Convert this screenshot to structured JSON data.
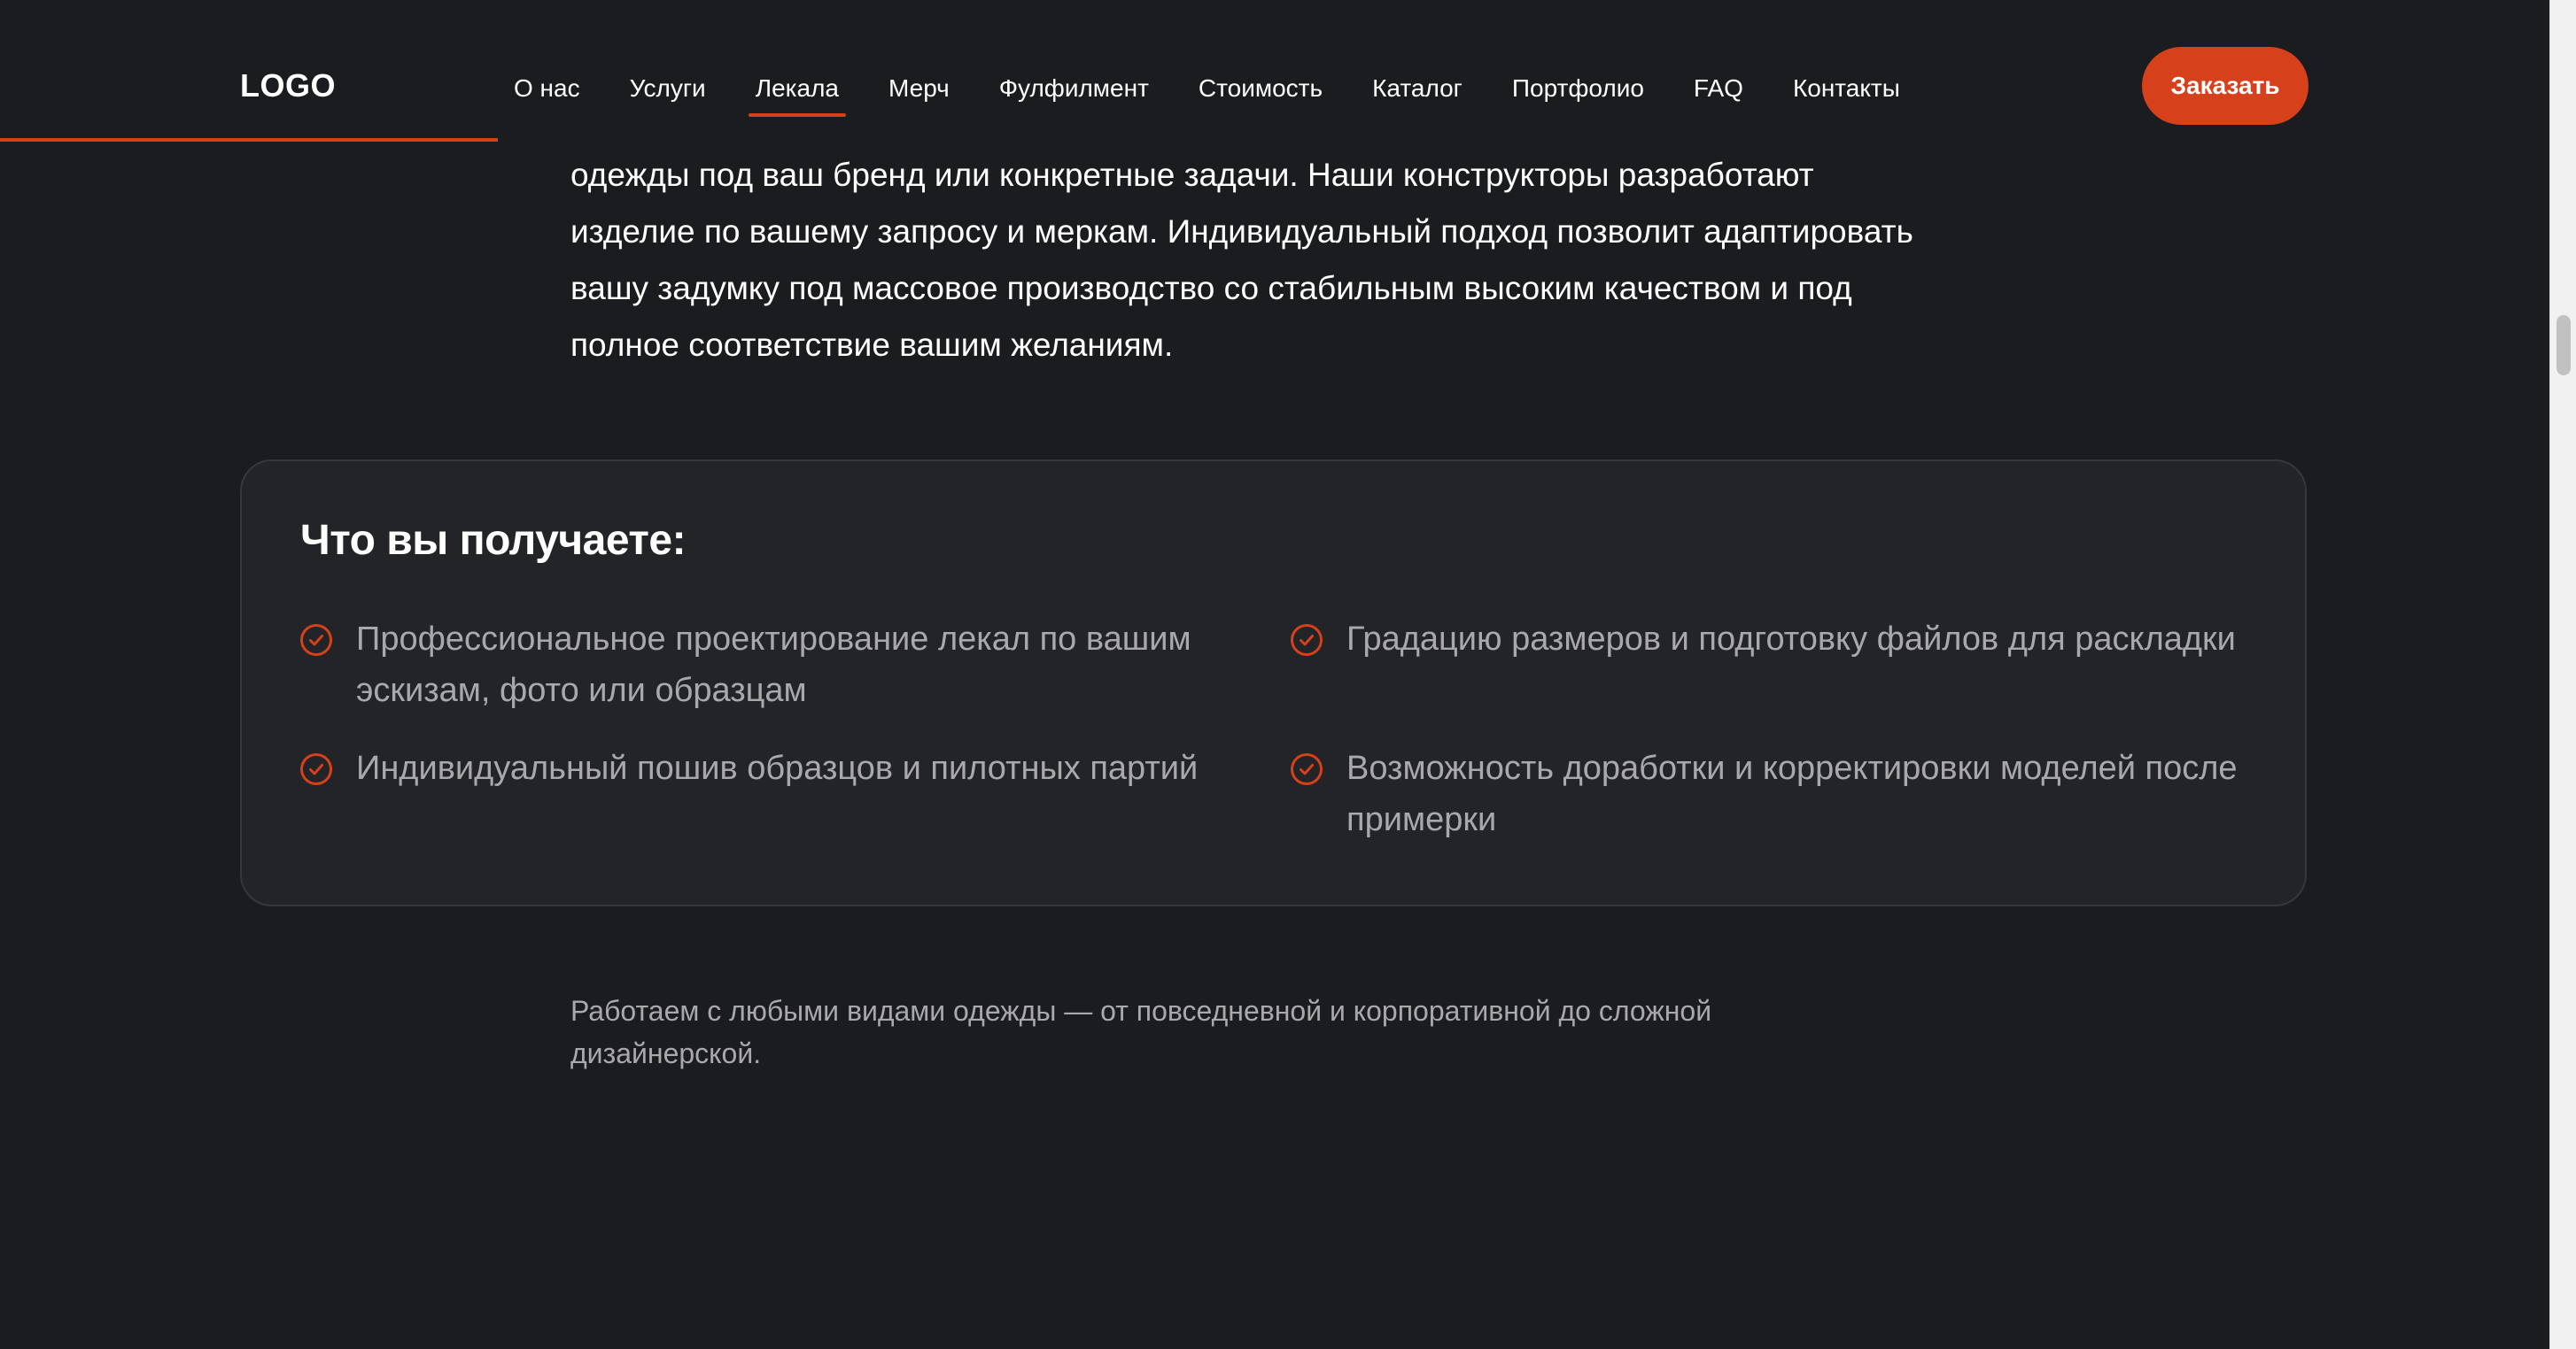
{
  "header": {
    "logo": "LOGO",
    "nav": [
      {
        "label": "О нас"
      },
      {
        "label": "Услуги"
      },
      {
        "label": "Лекала",
        "active": true
      },
      {
        "label": "Мерч"
      },
      {
        "label": "Фулфилмент"
      },
      {
        "label": "Стоимость"
      },
      {
        "label": "Каталог"
      },
      {
        "label": "Портфолио"
      },
      {
        "label": "FAQ"
      },
      {
        "label": "Контакты"
      }
    ],
    "order_button": "Заказать"
  },
  "intro": {
    "lines": [
      "одежды под ваш бренд или конкретные задачи. Наши конструкторы разработают",
      "изделие по вашему запросу и меркам. Индивидуальный подход позволит адаптировать",
      "вашу задумку под массовое производство со стабильным высоким качеством и под",
      "полное соответствие вашим желаниям."
    ]
  },
  "benefits": {
    "title": "Что вы получаете:",
    "icon": "check-circle-icon",
    "items": [
      {
        "text": "Профессиональное проектирование лекал по вашим эскизам, фото или образцам"
      },
      {
        "text": "Градацию размеров и подготовку файлов для раскладки"
      },
      {
        "text": "Индивидуальный пошив образцов и пилотных партий"
      },
      {
        "text": "Возможность доработки и корректировки моделей после примерки"
      }
    ]
  },
  "note": "Работаем с любыми видами одежды — от повседневной и корпоративной до сложной дизайнерской.",
  "colors": {
    "background": "#1b1c1f",
    "card": "#232427",
    "accent": "#d6401a",
    "muted_text": "#a9a9ad"
  }
}
